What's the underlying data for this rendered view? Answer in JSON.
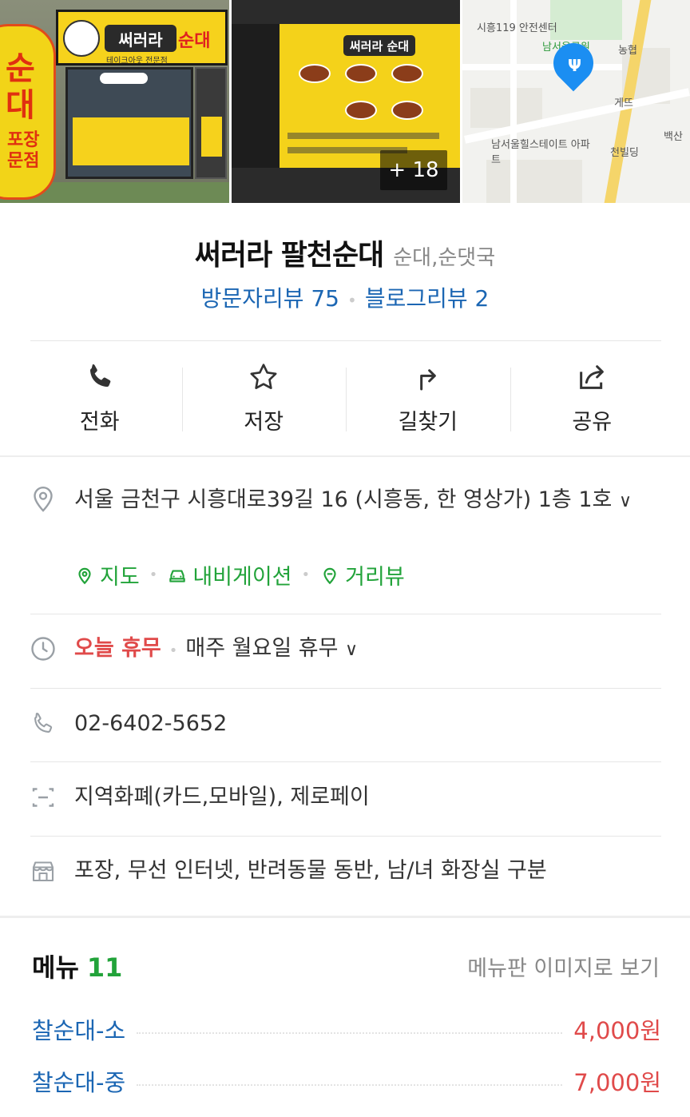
{
  "photos": {
    "storefront_sign_brand": "써러라",
    "storefront_sign_word": "순대",
    "storefront_sign_tag": "테이크아웃 전문점",
    "banner_vertical_1": "순대",
    "banner_vertical_2": "포장\n문점",
    "menu_board_brand": "써러라 순대",
    "more_count": "+ 18"
  },
  "map": {
    "labels": [
      "시흥119 안전센터",
      "남서울공원",
      "농협",
      "남서울힐스테이트 아파트",
      "천빌딩",
      "게뜨",
      "백산"
    ],
    "pin_icon": "restaurant-icon"
  },
  "place": {
    "name": "써러라 팔천순대",
    "category": "순대,순댓국",
    "visitor_reviews": "방문자리뷰 75",
    "blog_reviews": "블로그리뷰 2"
  },
  "actions": [
    {
      "label": "전화",
      "icon": "phone-icon"
    },
    {
      "label": "저장",
      "icon": "star-icon"
    },
    {
      "label": "길찾기",
      "icon": "directions-icon"
    },
    {
      "label": "공유",
      "icon": "share-icon"
    }
  ],
  "info": {
    "address": "서울 금천구 시흥대로39길 16 (시흥동, 한 영상가) 1층 1호",
    "links": [
      "지도",
      "내비게이션",
      "거리뷰"
    ],
    "today_status": "오늘 휴무",
    "regular_holiday": "매주 월요일 휴무",
    "phone": "02-6402-5652",
    "payment": "지역화폐(카드,모바일), 제로페이",
    "facilities": "포장, 무선 인터넷, 반려동물 동반, 남/녀 화장실 구분"
  },
  "menu": {
    "title": "메뉴",
    "count": "11",
    "view_image_link": "메뉴판 이미지로 보기",
    "items": [
      {
        "name": "찰순대-소",
        "price": "4,000원"
      },
      {
        "name": "찰순대-중",
        "price": "7,000원"
      }
    ]
  },
  "colors": {
    "link_blue": "#1b66b3",
    "green": "#22a33a",
    "red": "#e04a4a",
    "pin_blue": "#1b8ef2"
  }
}
